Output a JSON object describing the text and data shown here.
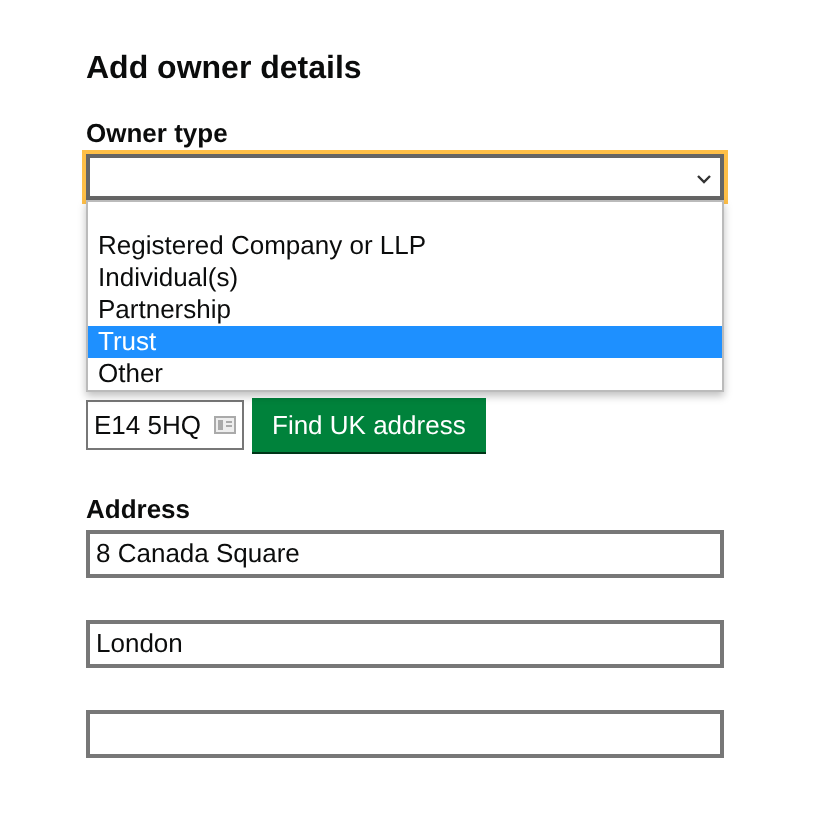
{
  "heading": "Add owner details",
  "owner_type": {
    "label": "Owner type",
    "options": [
      {
        "label": "Registered Company or LLP",
        "selected": false
      },
      {
        "label": "Individual(s)",
        "selected": false
      },
      {
        "label": "Partnership",
        "selected": false
      },
      {
        "label": "Trust",
        "selected": true
      },
      {
        "label": "Other",
        "selected": false
      }
    ]
  },
  "postcode": {
    "value": "E14 5HQ",
    "button": "Find UK address"
  },
  "address": {
    "label": "Address",
    "lines": [
      {
        "kind": "text",
        "value": "8 Canada Square"
      },
      {
        "kind": "text",
        "value": "London"
      },
      {
        "kind": "text"
      }
    ]
  }
}
